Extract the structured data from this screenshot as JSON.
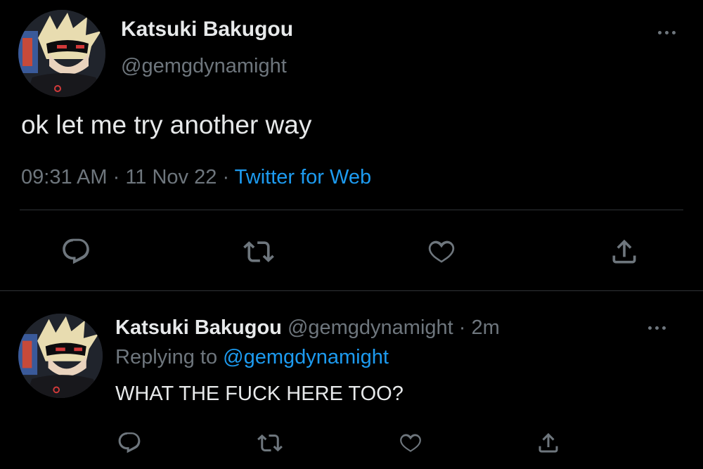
{
  "tweet": {
    "author_name": "Katsuki Bakugou",
    "author_handle": "@gemgdynamight",
    "text": "ok let me try another way",
    "time": "09:31 AM",
    "sep1": "·",
    "date": "11 Nov 22",
    "sep2": "·",
    "source": "Twitter for Web"
  },
  "reply": {
    "author_name": "Katsuki Bakugou",
    "author_handle": "@gemgdynamight",
    "sep": "·",
    "age": "2m",
    "replying_prefix": "Replying to",
    "replying_handle": "@gemgdynamight",
    "text": "WHAT THE FUCK HERE TOO?"
  },
  "icons": {
    "reply": "reply-icon",
    "retweet": "retweet-icon",
    "like": "heart-icon",
    "share": "share-icon",
    "more": "more-icon"
  },
  "colors": {
    "background": "#000000",
    "text": "#e7e9ea",
    "muted": "#6e767d",
    "accent": "#1d9bf0",
    "divider": "#2f3336"
  }
}
